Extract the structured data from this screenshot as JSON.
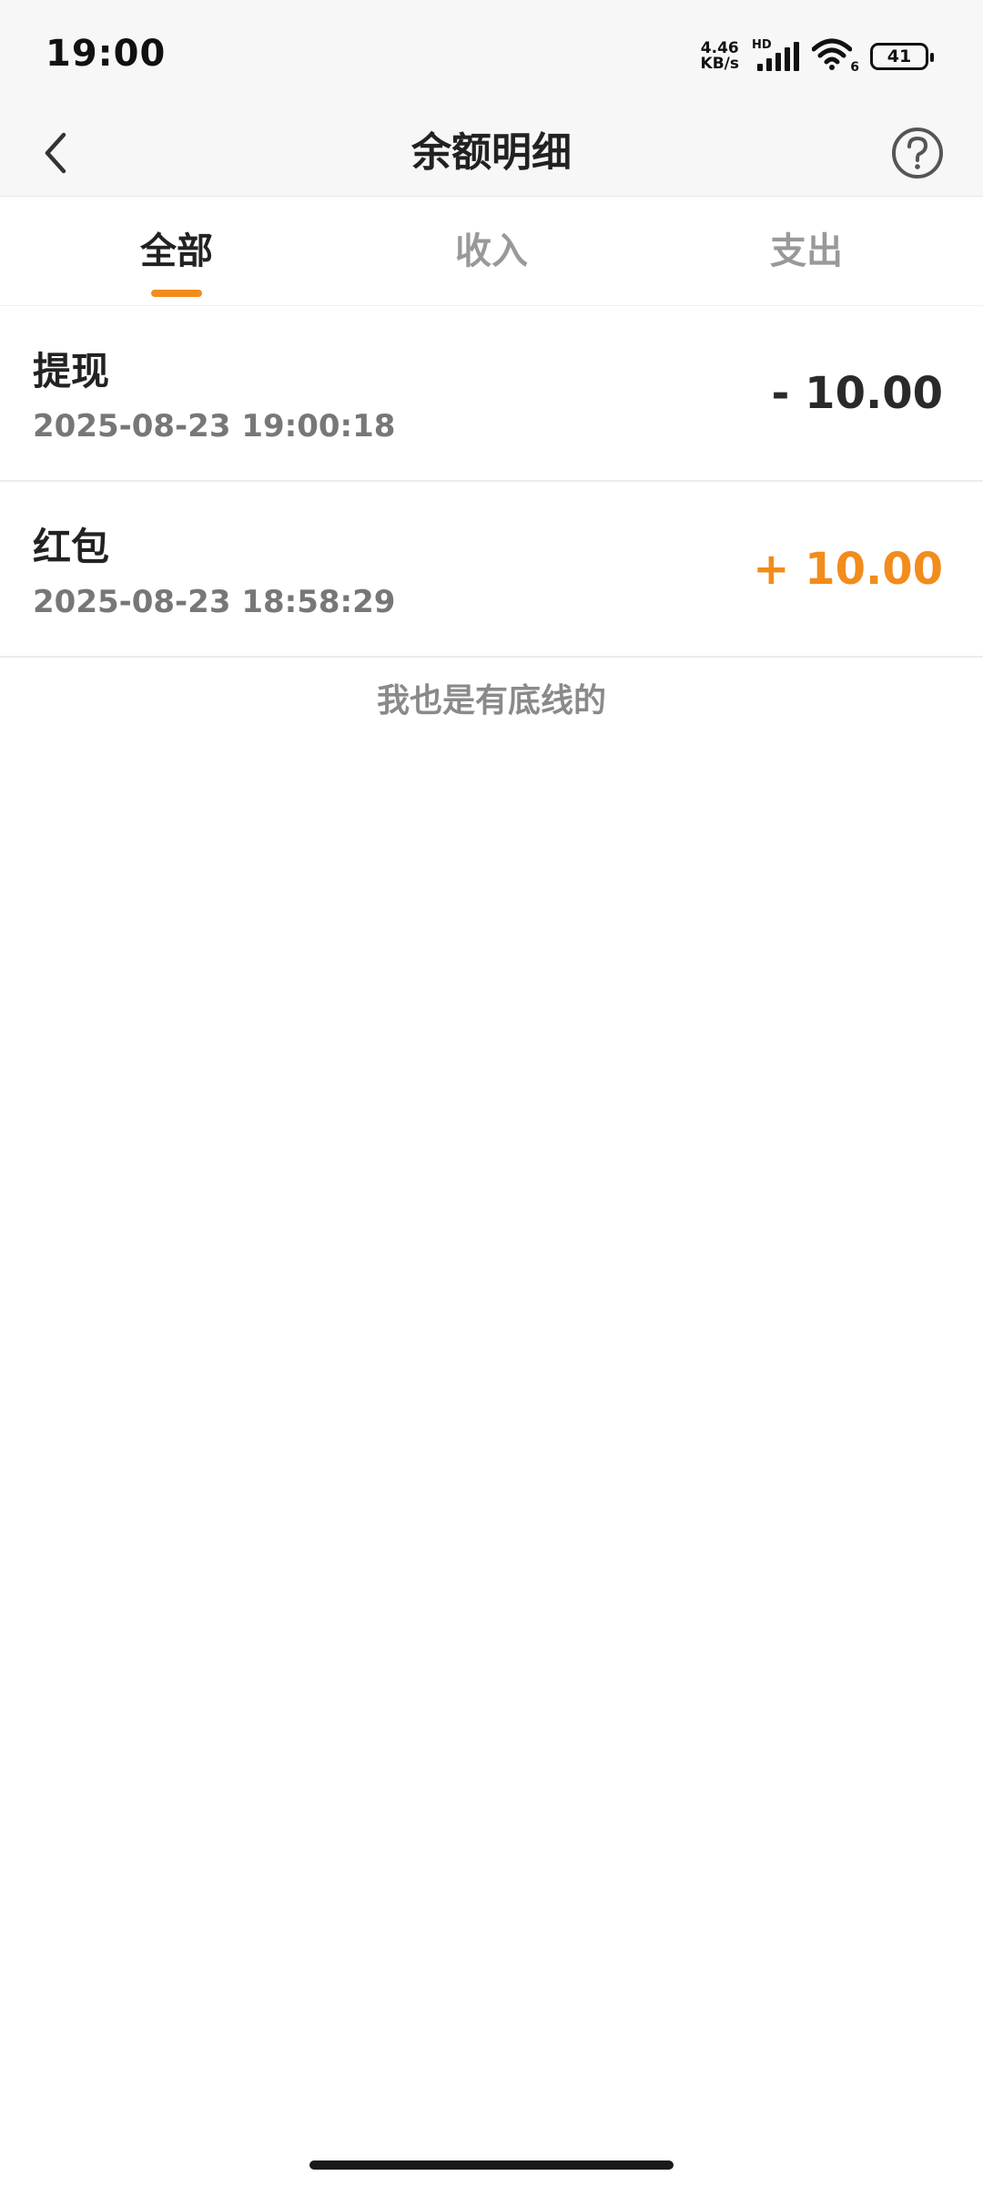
{
  "status_bar": {
    "time": "19:00",
    "network_speed_value": "4.46",
    "network_speed_unit": "KB/s",
    "signal_tag": "HD",
    "wifi_tag": "6",
    "battery_level": "41"
  },
  "header": {
    "title": "余额明细",
    "back_icon": "chevron-left-icon",
    "help_icon": "question-circle-icon"
  },
  "tabs": [
    {
      "label": "全部",
      "active": true
    },
    {
      "label": "收入",
      "active": false
    },
    {
      "label": "支出",
      "active": false
    }
  ],
  "transactions": [
    {
      "title": "提现",
      "time": "2025-08-23 19:00:18",
      "amount": "- 10.00",
      "type": "expense"
    },
    {
      "title": "红包",
      "time": "2025-08-23 18:58:29",
      "amount": "+ 10.00",
      "type": "income"
    }
  ],
  "footer_note": "我也是有底线的",
  "colors": {
    "accent": "#f28c1c",
    "text_primary": "#222222",
    "text_secondary": "#777777"
  }
}
